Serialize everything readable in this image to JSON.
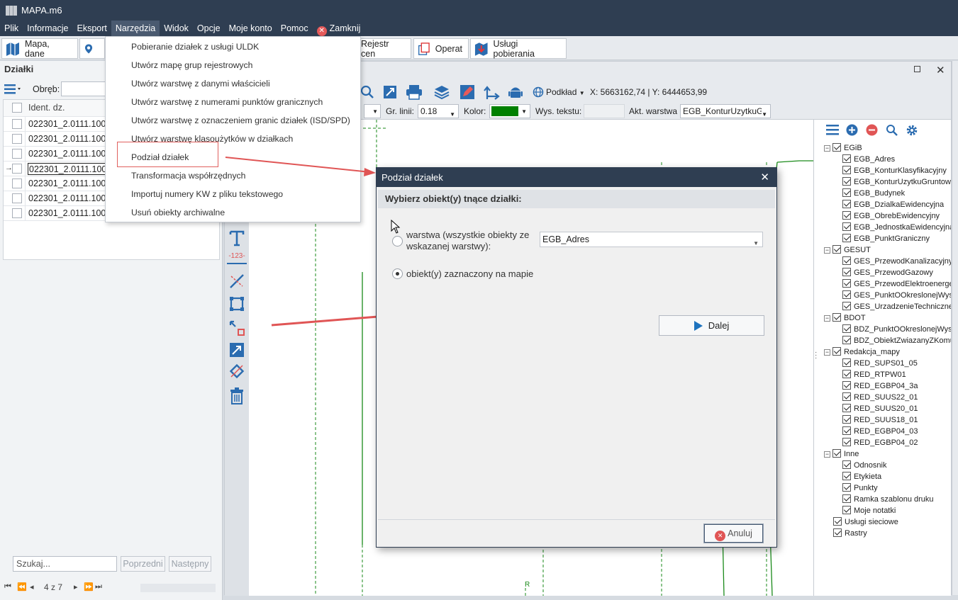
{
  "app": {
    "title": "MAPA.m6"
  },
  "menu": {
    "items": [
      "Plik",
      "Informacje",
      "Eksport",
      "Narzędzia",
      "Widok",
      "Opcje",
      "Moje konto",
      "Pomoc"
    ],
    "close_label": "Zamknij"
  },
  "tabs": {
    "map": "Mapa, dane",
    "price_register": "Rejestr cen",
    "operat": "Operat",
    "download_services": "Usługi pobierania"
  },
  "left_panel": {
    "title": "Działki",
    "precinct_label": "Obręb:",
    "column_header": "Ident. dz.",
    "rows": [
      "022301_2.0111.100",
      "022301_2.0111.100",
      "022301_2.0111.100",
      "022301_2.0111.100",
      "022301_2.0111.100",
      "022301_2.0111.100",
      "022301_2.0111.100"
    ],
    "search_placeholder": "Szukaj...",
    "prev_button": "Poprzedni",
    "next_button": "Następny",
    "page_info": "4 z 7"
  },
  "dropdown": {
    "items": [
      "Pobieranie działek z usługi ULDK",
      "Utwórz mapę grup rejestrowych",
      "Utwórz warstwę z danymi właścicieli",
      "Utwórz warstwę z numerami punktów granicznych",
      "Utwórz warstwę z oznaczeniem granic działek (ISD/SPD)",
      "Utwórz warstwę klasoużytków w działkach",
      "Podział działek",
      "Transformacja współrzędnych",
      "Importuj numery KW z pliku tekstowego",
      "Usuń obiekty archiwalne"
    ]
  },
  "map_toolbar": {
    "basemap_label": "Podkład",
    "coords": "X: 5663162,74 | Y: 6444653,99",
    "line_width_label": "Gr. linii:",
    "line_width_value": "0.18",
    "color_label": "Kolor:",
    "color_value": "#008000",
    "text_height_label": "Wys. tekstu:",
    "active_layer_label": "Akt. warstwa",
    "active_layer_value": "EGB_KonturUzytkuG",
    "ruler_label": "-123-"
  },
  "layers": {
    "groups": [
      {
        "name": "EGiB",
        "items": [
          "EGB_Adres",
          "EGB_KonturKlasyfikacyjny",
          "EGB_KonturUzytkuGruntowe",
          "EGB_Budynek",
          "EGB_DzialkaEwidencyjna",
          "EGB_ObrebEwidencyjny",
          "EGB_JednostkaEwidencyjna",
          "EGB_PunktGraniczny"
        ]
      },
      {
        "name": "GESUT",
        "items": [
          "GES_PrzewodKanalizacyjny",
          "GES_PrzewodGazowy",
          "GES_PrzewodElektroenerget",
          "GES_PunktOOkreslonejWyso",
          "GES_UrzadzenieTechniczneZ"
        ]
      },
      {
        "name": "BDOT",
        "items": [
          "BDZ_PunktOOkreslonejWyso",
          "BDZ_ObiektZwiazanyZKomur"
        ]
      },
      {
        "name": "Redakcja_mapy",
        "items": [
          "RED_SUPS01_05",
          "RED_RTPW01",
          "RED_EGBP04_3a",
          "RED_SUUS22_01",
          "RED_SUUS20_01",
          "RED_SUUS18_01",
          "RED_EGBP04_03",
          "RED_EGBP04_02"
        ]
      },
      {
        "name": "Inne",
        "items": [
          "Odnosnik",
          "Etykieta",
          "Punkty",
          "Ramka szablonu druku",
          "Moje notatki"
        ]
      }
    ],
    "extra": [
      "Usługi sieciowe",
      "Rastry"
    ]
  },
  "dialog": {
    "title": "Podział działek",
    "header": "Wybierz obiekt(y) tnące działki:",
    "option_layer": "warstwa (wszystkie obiekty ze wskazanej warstwy):",
    "option_layer_value": "EGB_Adres",
    "option_selected": "obiekt(y) zaznaczony na mapie",
    "next_button": "Dalej",
    "cancel_button": "Anuluj"
  },
  "canvas": {
    "label_r": "R"
  },
  "colors": {
    "titlebar": "#2f3e52",
    "accent": "#1e73be",
    "highlight": "#e0605e",
    "map_line": "#1a8a1a"
  }
}
